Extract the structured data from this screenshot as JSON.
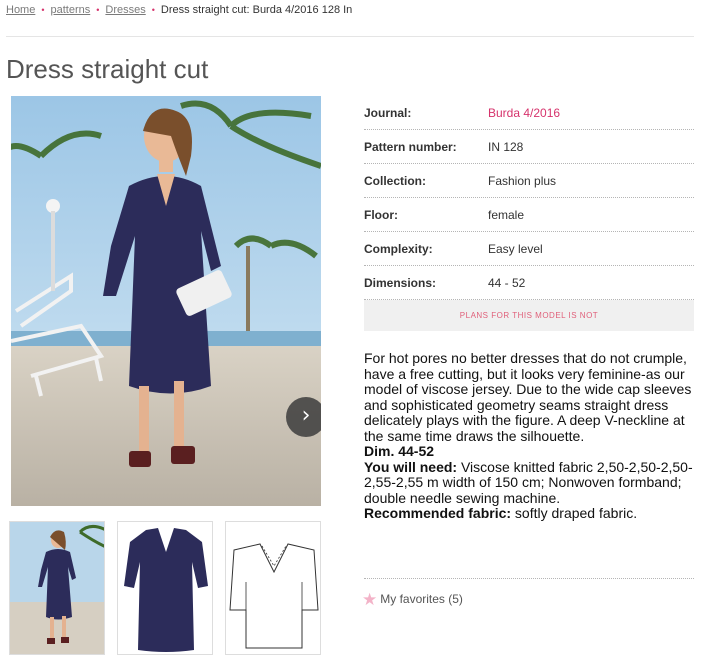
{
  "breadcrumb": {
    "items": [
      "Home",
      "patterns",
      "Dresses"
    ],
    "current": "Dress straight cut: Burda 4/2016 128 In"
  },
  "title": "Dress straight cut",
  "specs": [
    {
      "label": "Journal:",
      "value": "Burda 4/2016"
    },
    {
      "label": "Pattern number:",
      "value": "IN 128"
    },
    {
      "label": "Collection:",
      "value": "Fashion plus"
    },
    {
      "label": "Floor:",
      "value": "female"
    },
    {
      "label": "Complexity:",
      "value": "Easy level"
    },
    {
      "label": "Dimensions:",
      "value": "44 - 52"
    }
  ],
  "plans_text": "PLANS FOR THIS MODEL IS NOT",
  "description": {
    "intro": "For hot pores no better dresses that do not crumple, have a free cutting, but it looks very feminine-as our model of viscose jersey. Due to the wide cap sleeves and sophisticated geometry seams straight dress delicately plays with the figure. A deep V-neckline at the same time draws the silhouette.",
    "dim": "Dim. 44-52",
    "need_label": "You will need:",
    "need_text": " Viscose knitted fabric 2,50-2,50-2,50-2,55-2,55 m width of 150 cm; Nonwoven formband; double needle sewing machine.",
    "fabric_label": "Recommended fabric:",
    "fabric_text": " softly draped fabric."
  },
  "favorites": "My favorites (5)",
  "colors": {
    "accent": "#d6336c",
    "dress": "#2c2c5a"
  },
  "icons": {
    "next": "chevron-right-icon",
    "favorite": "star-icon"
  }
}
